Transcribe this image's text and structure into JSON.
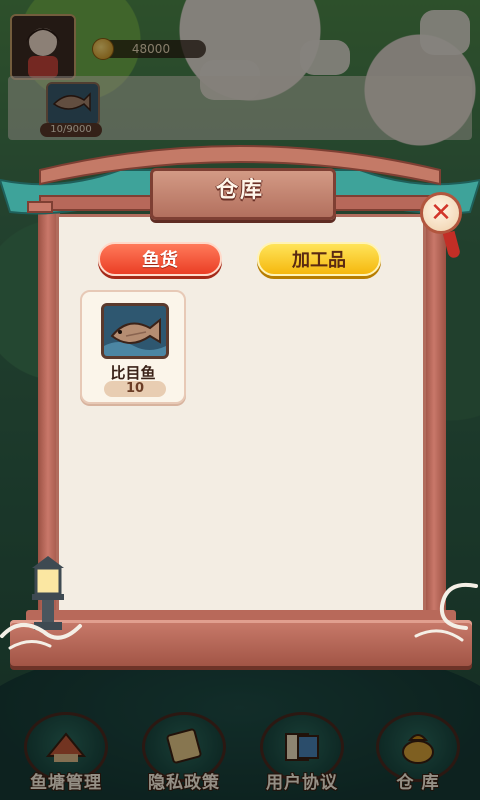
{
  "hud": {
    "coins": "48000",
    "fish_count": "10/9000"
  },
  "warehouse": {
    "title": "仓库",
    "close_label": "✕",
    "tabs": [
      {
        "label": "鱼货",
        "active": true
      },
      {
        "label": "加工品",
        "active": false
      }
    ],
    "items": [
      {
        "name": "比目鱼",
        "quantity": "10",
        "icon": "flatfish-icon"
      }
    ]
  },
  "bottom_nav": [
    {
      "label": "鱼塘管理",
      "icon": "fishpond-icon"
    },
    {
      "label": "隐私政策",
      "icon": "scroll-icon"
    },
    {
      "label": "用户协议",
      "icon": "document-icon"
    },
    {
      "label": "仓  库",
      "icon": "treasure-bag-icon"
    }
  ],
  "colors": {
    "frame": "#b16c5d",
    "panel": "#f3ede3",
    "tab_fish": "#ea3e25",
    "tab_processed": "#f5b80e",
    "close_x": "#d2352a"
  }
}
